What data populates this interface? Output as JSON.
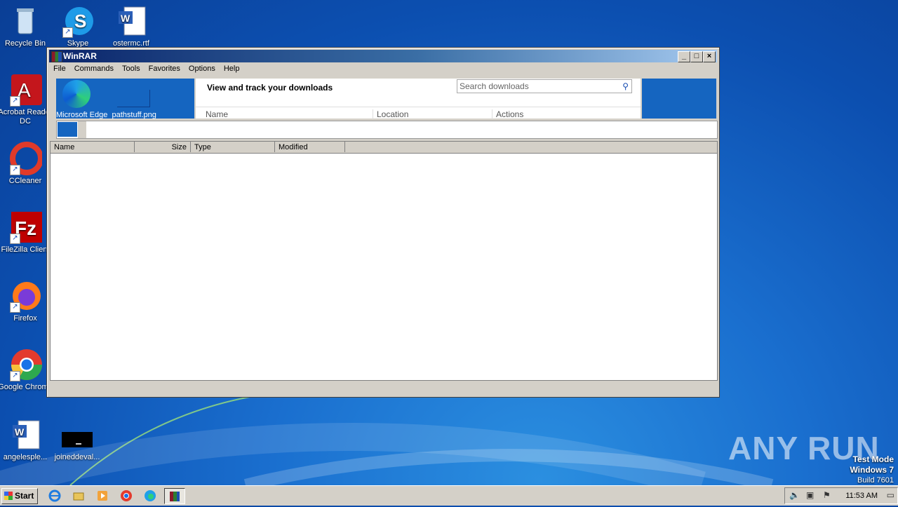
{
  "desktop": {
    "icons": [
      {
        "label": "Recycle Bin"
      },
      {
        "label": "Skype"
      },
      {
        "label": "ostermc.rtf"
      },
      {
        "label": "Acrobat Reader DC"
      },
      {
        "label": "CCleaner"
      },
      {
        "label": "FileZilla Client"
      },
      {
        "label": "Firefox"
      },
      {
        "label": "Google Chrome"
      },
      {
        "label": "angelesple..."
      },
      {
        "label": "joineddeval..."
      }
    ],
    "watermark": "ANY RUN",
    "test_mode": {
      "line1": "Test Mode",
      "line2": "Windows 7",
      "line3": "Build 7601"
    }
  },
  "window": {
    "title": "WinRAR",
    "menu": [
      "File",
      "Commands",
      "Tools",
      "Favorites",
      "Options",
      "Help"
    ],
    "overlay": {
      "edge_label": "Microsoft Edge",
      "file_label": "pathstuff.png",
      "downloads_heading": "View and track your downloads",
      "search_placeholder": "Search downloads",
      "columns": [
        "Name",
        "Location",
        "Actions"
      ]
    },
    "file_list": {
      "columns": [
        "Name",
        "Size",
        "Type",
        "Modified"
      ],
      "rows": []
    }
  },
  "taskbar": {
    "start_label": "Start",
    "clock": "11:53 AM"
  },
  "colors": {
    "desktop_blue": "#0c4fb0",
    "edge_blue": "#1565c0",
    "window_gray": "#d4d0c8",
    "title_dark": "#0a246a"
  }
}
